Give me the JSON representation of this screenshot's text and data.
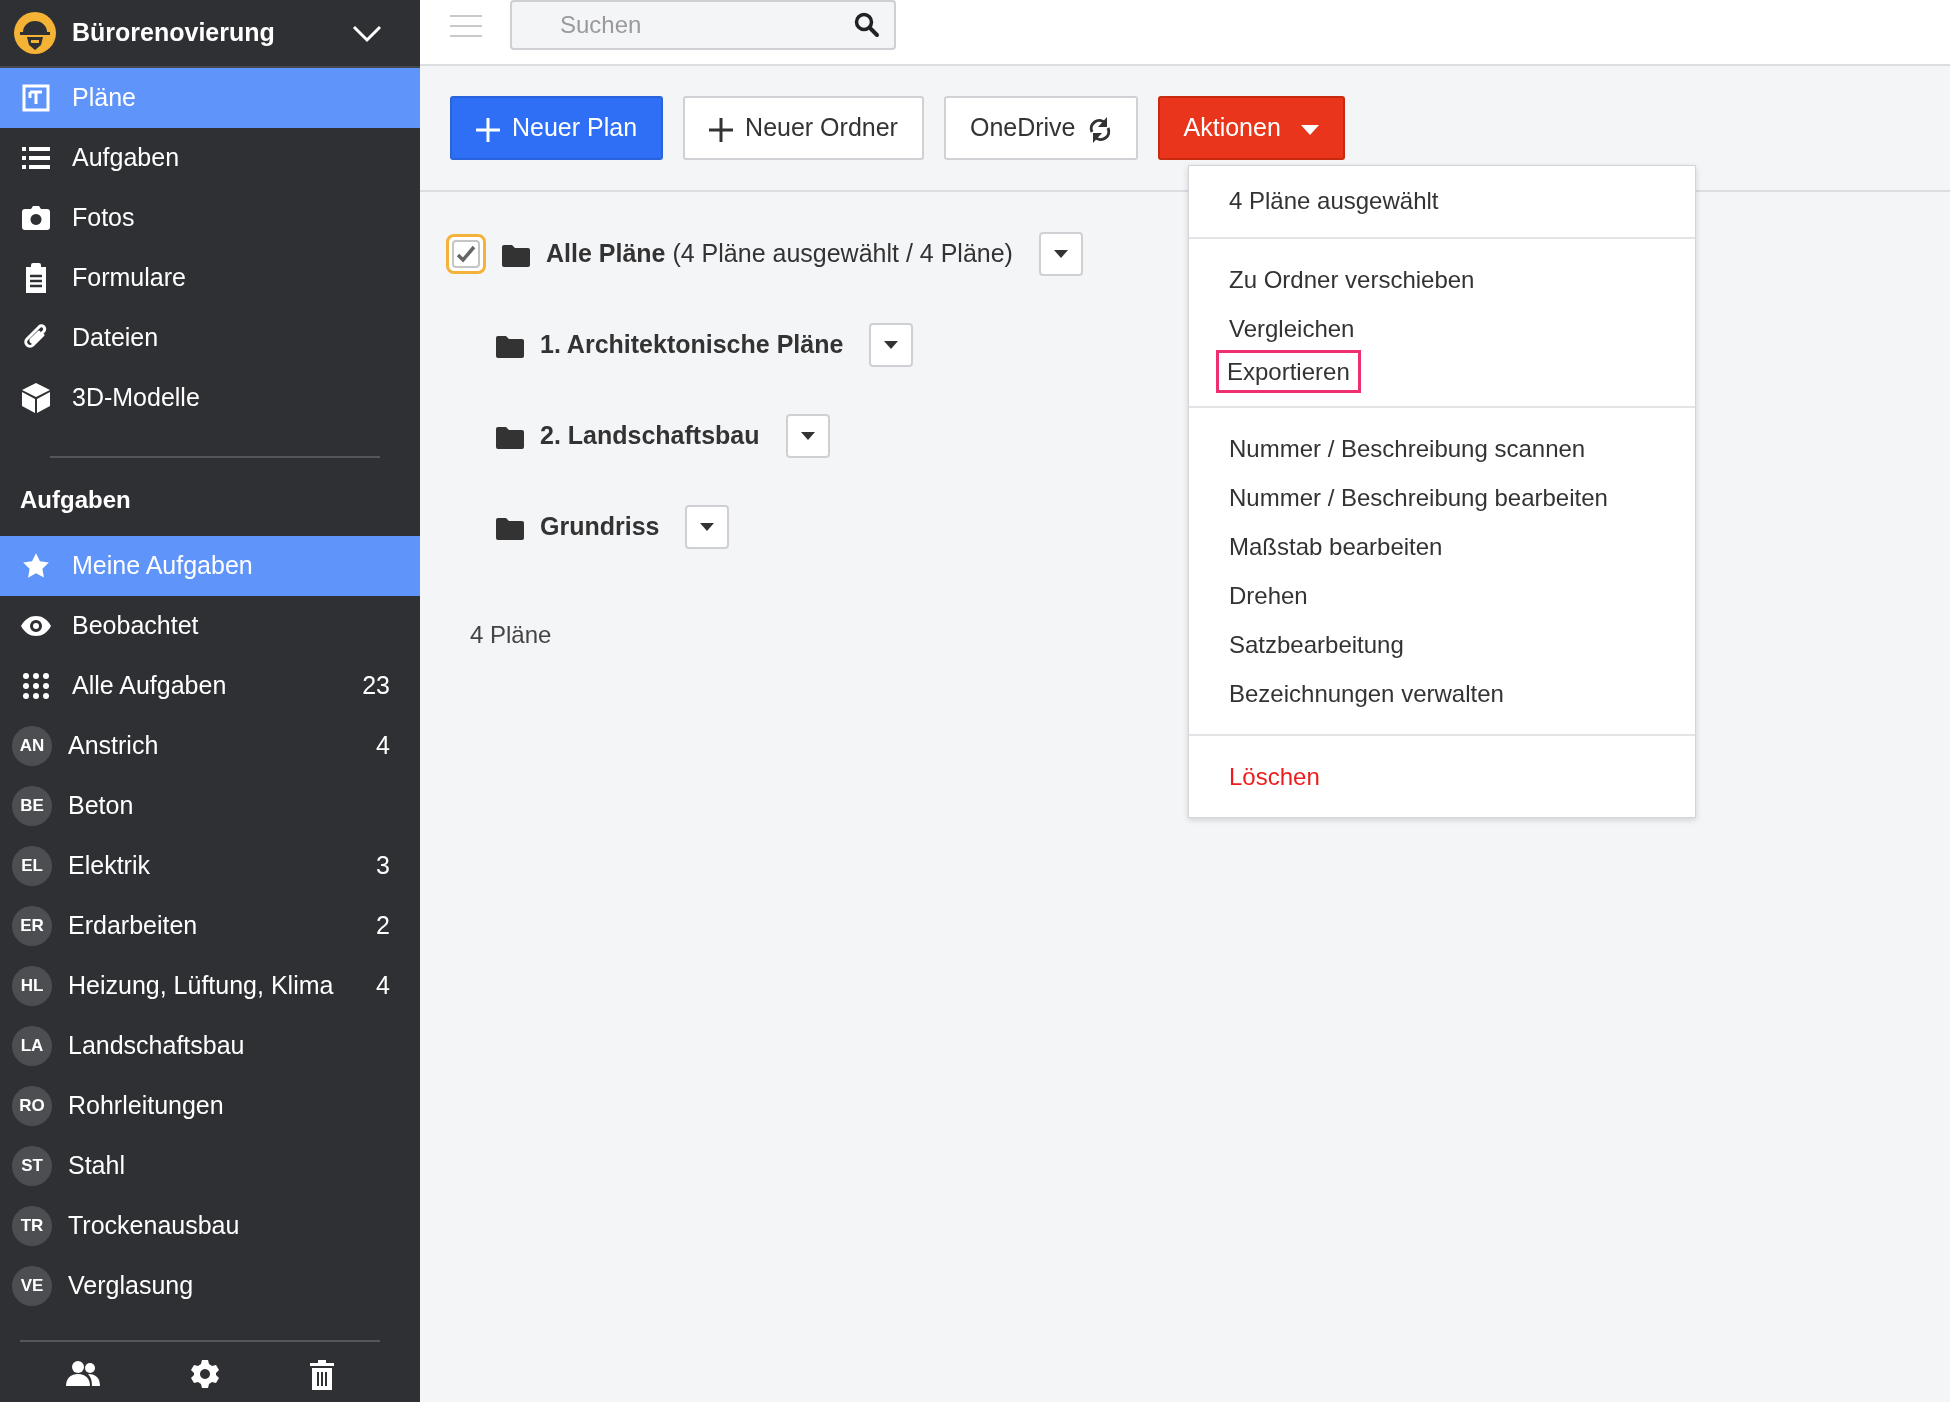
{
  "project": {
    "title": "Bürorenovierung"
  },
  "nav": [
    {
      "label": "Pläne",
      "selected": true
    },
    {
      "label": "Aufgaben",
      "selected": false
    },
    {
      "label": "Fotos",
      "selected": false
    },
    {
      "label": "Formulare",
      "selected": false
    },
    {
      "label": "Dateien",
      "selected": false
    },
    {
      "label": "3D-Modelle",
      "selected": false
    }
  ],
  "tasks_heading": "Aufgaben",
  "task_filters": [
    {
      "label": "Meine Aufgaben",
      "selected": true
    },
    {
      "label": "Beobachtet",
      "selected": false
    },
    {
      "label": "Alle Aufgaben",
      "count": "23",
      "selected": false
    },
    {
      "label": "Anstrich",
      "initials": "AN",
      "count": "4",
      "selected": false
    },
    {
      "label": "Beton",
      "initials": "BE",
      "selected": false
    },
    {
      "label": "Elektrik",
      "initials": "EL",
      "count": "3",
      "selected": false
    },
    {
      "label": "Erdarbeiten",
      "initials": "ER",
      "count": "2",
      "selected": false
    },
    {
      "label": "Heizung, Lüftung, Klima",
      "initials": "HL",
      "count": "4",
      "selected": false
    },
    {
      "label": "Landschaftsbau",
      "initials": "LA",
      "selected": false
    },
    {
      "label": "Rohrleitungen",
      "initials": "RO",
      "selected": false
    },
    {
      "label": "Stahl",
      "initials": "ST",
      "selected": false
    },
    {
      "label": "Trockenausbau",
      "initials": "TR",
      "selected": false
    },
    {
      "label": "Verglasung",
      "initials": "VE",
      "selected": false
    }
  ],
  "search": {
    "placeholder": "Suchen"
  },
  "toolbar": [
    {
      "label": "Neuer Plan",
      "kind": "primary"
    },
    {
      "label": "Neuer Ordner",
      "kind": "add"
    },
    {
      "label": "OneDrive",
      "kind": "sync"
    },
    {
      "label": "Aktionen",
      "kind": "dropdown"
    }
  ],
  "tree": {
    "label": "**Alle Pläne** (4 Pläne ausgewählt / 4 Pläne)",
    "checked": true,
    "children": [
      {
        "label": "1. Architektonische Pläne"
      },
      {
        "label": "2. Landschaftsbau"
      },
      {
        "label": "Grundriss"
      }
    ]
  },
  "count_label": "4 Pläne",
  "menu": [
    [
      {
        "label": "4 Pläne ausgewählt",
        "kind": "header",
        "highlighted": false
      }
    ],
    [
      {
        "label": "Zu Ordner verschieben",
        "kind": "action",
        "highlighted": false
      },
      {
        "label": "Vergleichen",
        "kind": "action",
        "highlighted": false
      },
      {
        "label": "Exportieren",
        "kind": "action",
        "highlighted": true
      }
    ],
    [
      {
        "label": "Nummer / Beschreibung scannen",
        "kind": "action",
        "highlighted": false
      },
      {
        "label": "Nummer / Beschreibung bearbeiten",
        "kind": "action",
        "highlighted": false
      },
      {
        "label": "Maßstab bearbeiten",
        "kind": "action",
        "highlighted": false
      },
      {
        "label": "Drehen",
        "kind": "action",
        "highlighted": false
      },
      {
        "label": "Satzbearbeitung",
        "kind": "action",
        "highlighted": false
      },
      {
        "label": "Bezeichnungen verwalten",
        "kind": "action",
        "highlighted": false
      }
    ],
    [
      {
        "label": "Löschen",
        "kind": "danger",
        "highlighted": false
      }
    ]
  ]
}
